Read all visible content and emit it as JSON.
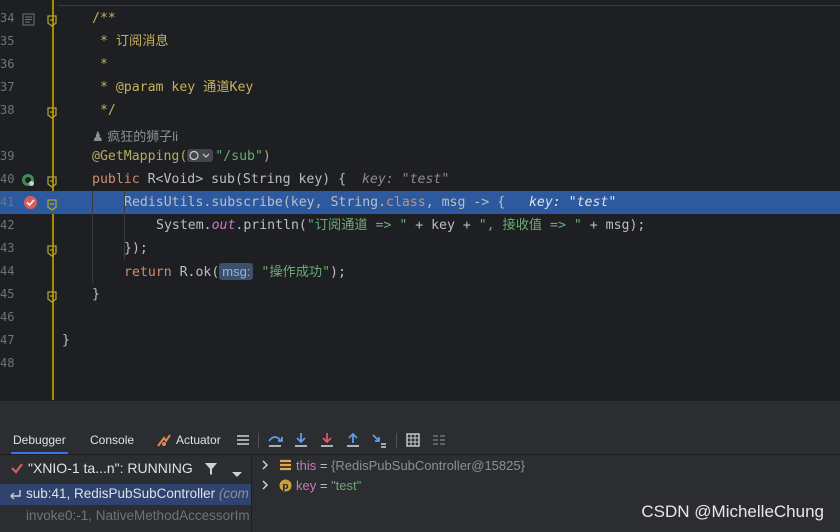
{
  "editor": {
    "lines": [
      {
        "num": "34",
        "segments": [
          {
            "t": "/**",
            "c": "cmt"
          }
        ]
      },
      {
        "num": "35",
        "segments": [
          {
            "t": " * 订阅消息",
            "c": "cmt"
          }
        ]
      },
      {
        "num": "36",
        "segments": [
          {
            "t": " *",
            "c": "cmt"
          }
        ]
      },
      {
        "num": "37",
        "segments": [
          {
            "t": " * @param key 通道Key",
            "c": "cmt"
          }
        ]
      },
      {
        "num": "38",
        "segments": [
          {
            "t": " */",
            "c": "cmt"
          }
        ]
      },
      {
        "num": "39",
        "segments": [
          {
            "t": "@GetMapping(",
            "c": "ann"
          },
          {
            "t": "\"/sub\"",
            "c": "str"
          },
          {
            "t": ")",
            "c": "ann"
          }
        ]
      },
      {
        "num": "40",
        "segments": [
          {
            "t": "public ",
            "c": "kw"
          },
          {
            "t": "R<Void> ",
            "c": "cls"
          },
          {
            "t": "sub",
            "c": "cls"
          },
          {
            "t": "(String key) {",
            "c": "cls"
          },
          {
            "t": "  key: \"test\"",
            "c": "hint"
          }
        ]
      },
      {
        "num": "41",
        "segments": [
          {
            "t": "RedisUtils.",
            "c": "cls"
          },
          {
            "t": "subscribe",
            "c": "cls"
          },
          {
            "t": "(key, String.",
            "c": "cls"
          },
          {
            "t": "class",
            "c": "kw"
          },
          {
            "t": ", msg -> {",
            "c": "cls"
          },
          {
            "t": "   key: \"test\"",
            "c": "hint"
          }
        ]
      },
      {
        "num": "42",
        "segments": [
          {
            "t": "System.",
            "c": "cls"
          },
          {
            "t": "out",
            "c": "field"
          },
          {
            "t": ".println(",
            "c": "cls"
          },
          {
            "t": "\"订阅通道 => \"",
            "c": "str"
          },
          {
            "t": " + key + ",
            "c": "cls"
          },
          {
            "t": "\", 接收值 => \"",
            "c": "str"
          },
          {
            "t": " + msg);",
            "c": "cls"
          }
        ]
      },
      {
        "num": "43",
        "segments": [
          {
            "t": "});",
            "c": "cls"
          }
        ]
      },
      {
        "num": "44",
        "segments": [
          {
            "t": "return ",
            "c": "kw"
          },
          {
            "t": "R.ok(",
            "c": "cls"
          },
          {
            "t": "msg:",
            "c": "pill"
          },
          {
            "t": "\"操作成功\"",
            "c": "str"
          },
          {
            "t": ");",
            "c": "cls"
          }
        ]
      },
      {
        "num": "45",
        "segments": [
          {
            "t": "}",
            "c": "cls"
          }
        ]
      },
      {
        "num": "46",
        "segments": []
      },
      {
        "num": "47",
        "segments": [
          {
            "t": "}",
            "c": "cls"
          }
        ]
      },
      {
        "num": "48",
        "segments": []
      }
    ],
    "author": "疯狂的狮子li"
  },
  "debug": {
    "tabs": [
      "Debugger",
      "Console",
      "Actuator"
    ],
    "thread": "\"XNIO-1 ta...n\": RUNNING",
    "frames": [
      {
        "label": "sub:41, RedisPubSubController",
        "extra": " (com"
      },
      {
        "label": "invoke0:-1, NativeMethodAccessorIm",
        "extra": ""
      }
    ],
    "variables": [
      {
        "name": "this",
        "value": "{RedisPubSubController@15825}",
        "icon": "list-icon"
      },
      {
        "name": "key",
        "value": "\"test\"",
        "icon": "parameter-icon"
      }
    ]
  },
  "watermark": "CSDN @MichelleChung",
  "colors": {
    "accent": "#3574f0",
    "current_line": "#2d5a9e",
    "gutter_sep": "#a88a00",
    "breakpoint": "#db5c5c"
  }
}
